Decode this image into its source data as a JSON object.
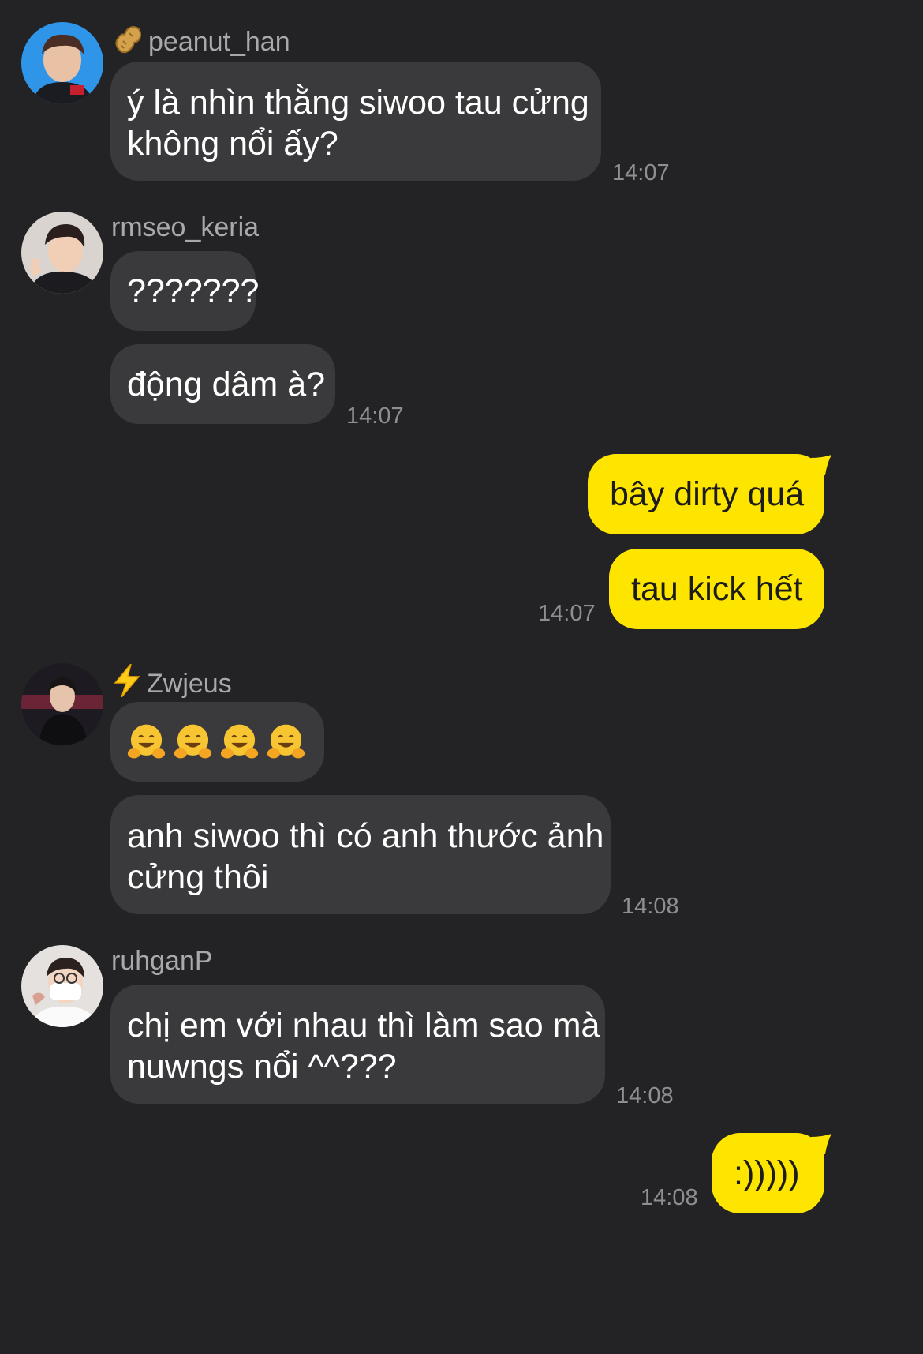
{
  "colors": {
    "background": "#232325",
    "incoming_bubble": "#3a3a3c",
    "outgoing_bubble": "#fee500",
    "sender_name": "#a9a9ad",
    "timestamp": "#8e8e93"
  },
  "messages": [
    {
      "sender": "peanut_han",
      "sender_badge": "peanut-icon",
      "bubbles": [
        {
          "lines": [
            "ý là nhìn thằng siwoo tau cửng",
            "không nổi ấy?"
          ]
        }
      ],
      "time": "14:07"
    },
    {
      "sender": "rmseo_keria",
      "bubbles": [
        {
          "lines": [
            "???????"
          ]
        },
        {
          "lines": [
            "động dâm à?"
          ]
        }
      ],
      "time": "14:07"
    },
    {
      "outgoing": true,
      "bubbles": [
        {
          "lines": [
            "bây dirty quá"
          ]
        },
        {
          "lines": [
            "tau kick hết"
          ]
        }
      ],
      "time": "14:07"
    },
    {
      "sender": "Zwjeus",
      "sender_badge": "lightning-icon",
      "bubbles": [
        {
          "emoji": [
            "hugging-face",
            "hugging-face",
            "hugging-face",
            "hugging-face"
          ]
        },
        {
          "lines": [
            "anh siwoo thì có anh thước ảnh",
            "cửng thôi"
          ]
        }
      ],
      "time": "14:08"
    },
    {
      "sender": "ruhganP",
      "bubbles": [
        {
          "lines": [
            "chị em với nhau thì làm sao mà",
            "nuwngs nổi ^^???"
          ]
        }
      ],
      "time": "14:08"
    },
    {
      "outgoing": true,
      "bubbles": [
        {
          "lines": [
            ":)))))"
          ]
        }
      ],
      "time": "14:08"
    }
  ]
}
